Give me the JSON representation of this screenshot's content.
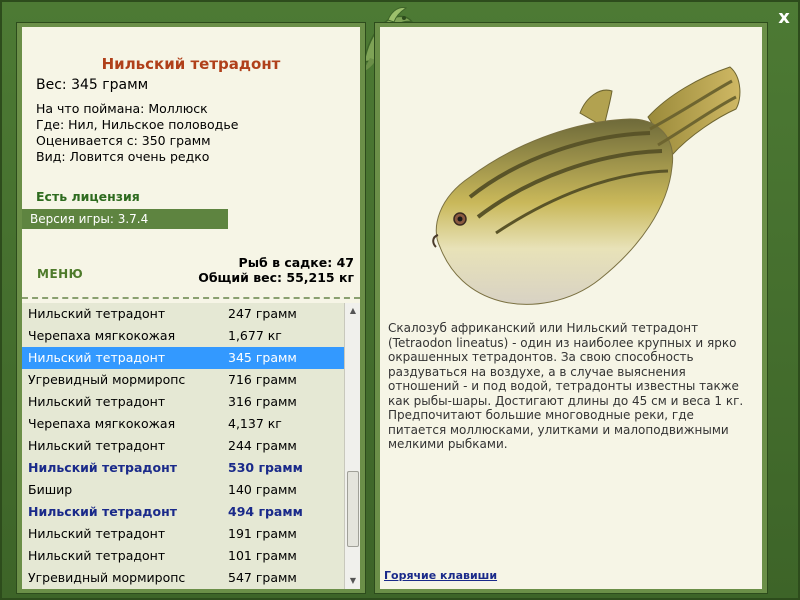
{
  "window": {
    "close_glyph": "x"
  },
  "fish": {
    "title": "Нильский тетрадонт",
    "weight": "Вес: 345 грамм",
    "bait": "На что поймана: Моллюск",
    "location": "Где: Нил, Нильское половодье",
    "value": "Оценивается с: 350 грамм",
    "rarity": "Вид: Ловится очень редко"
  },
  "license": "Есть лицензия",
  "version": "Версия игры: 3.7.4",
  "menu_label": "МЕНЮ",
  "stats": {
    "count": "Рыб в садке: 47",
    "total": "Общий вес: 55,215 кг"
  },
  "catch_list": [
    {
      "name": "Нильский тетрадонт",
      "weight": "247 грамм",
      "style": ""
    },
    {
      "name": "Черепаха мягкокожая",
      "weight": "1,677 кг",
      "style": ""
    },
    {
      "name": "Нильский тетрадонт",
      "weight": "345 грамм",
      "style": "selected"
    },
    {
      "name": "Угревидный мормиропс",
      "weight": "716 грамм",
      "style": ""
    },
    {
      "name": "Нильский тетрадонт",
      "weight": "316 грамм",
      "style": ""
    },
    {
      "name": "Черепаха мягкокожая",
      "weight": "4,137 кг",
      "style": ""
    },
    {
      "name": "Нильский тетрадонт",
      "weight": "244 грамм",
      "style": ""
    },
    {
      "name": "Нильский тетрадонт",
      "weight": "530 грамм",
      "style": "bold"
    },
    {
      "name": "Бишир",
      "weight": "140 грамм",
      "style": ""
    },
    {
      "name": "Нильский тетрадонт",
      "weight": "494 грамм",
      "style": "bold"
    },
    {
      "name": "Нильский тетрадонт",
      "weight": "191 грамм",
      "style": ""
    },
    {
      "name": "Нильский тетрадонт",
      "weight": "101 грамм",
      "style": ""
    },
    {
      "name": "Угревидный мормиропс",
      "weight": "547 грамм",
      "style": ""
    }
  ],
  "description": "Скалозуб африканский или Нильский тетрадонт (Tetraodon lineatus) - один из наиболее крупных и ярко окрашенных тетрадонтов. За свою способность раздуваться на воздухе, а в случае выяснения отношений - и под водой, тетрадонты известны также как рыбы-шары. Достигают длины до 45 см и веса 1 кг. Предпочитают большие многоводные реки, где питается моллюсками, улитками и малоподвижными мелкими рыбками.",
  "hotkeys_label": "Горячие клавиши",
  "colors": {
    "frame": "#3f6a2a",
    "panel": "#f6f5e6",
    "title": "#b0401a",
    "selected": "#3399ff",
    "license": "#2e6b1f"
  }
}
